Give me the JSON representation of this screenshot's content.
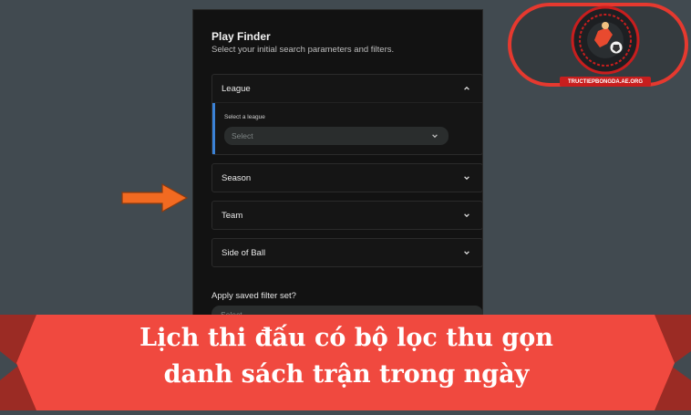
{
  "panel": {
    "title": "Play Finder",
    "subtitle": "Select your initial search parameters and filters.",
    "sections": [
      {
        "label": "League",
        "expanded": true
      },
      {
        "label": "Season",
        "expanded": false
      },
      {
        "label": "Team",
        "expanded": false
      },
      {
        "label": "Side of Ball",
        "expanded": false
      }
    ],
    "league": {
      "field_label": "Select a league",
      "select_placeholder": "Select"
    },
    "saved_filter": {
      "label": "Apply saved filter set?",
      "placeholder": "Select"
    }
  },
  "badge": {
    "url": "TRUCTIEPBONGDA.AE.ORG"
  },
  "banner": {
    "line1": "Lịch thi đấu có bộ lọc thu gọn",
    "line2": "danh sách trận trong ngày"
  },
  "colors": {
    "accent": "#3b82d6",
    "banner": "#f0493f",
    "arrow": "#f26a21",
    "badge_border": "#e5392f"
  },
  "icons": [
    "chevron-up-icon",
    "chevron-down-icon",
    "arrow-right-icon",
    "logo-icon"
  ]
}
